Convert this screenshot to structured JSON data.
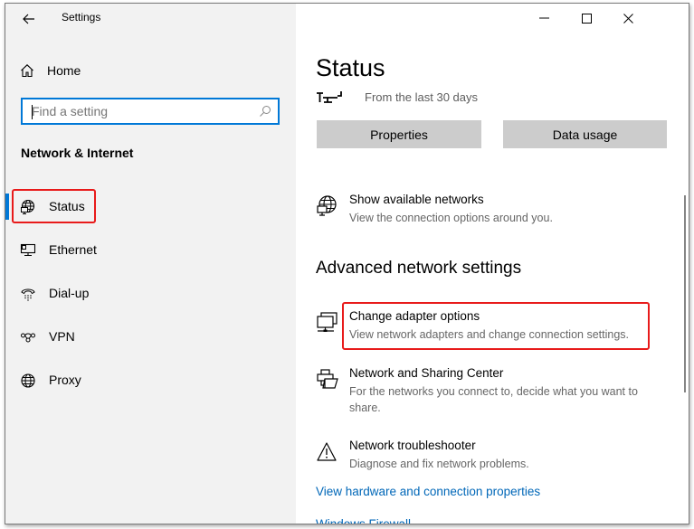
{
  "window": {
    "title": "Settings",
    "controls": {
      "minimize": "minimize-icon",
      "maximize": "maximize-icon",
      "close": "close-icon"
    }
  },
  "sidebar": {
    "back_icon": "back-arrow-icon",
    "home_label": "Home",
    "search": {
      "placeholder": "Find a setting",
      "value": "",
      "icon": "search-icon"
    },
    "section_label": "Network & Internet",
    "selected_index": 0,
    "items": [
      {
        "label": "Status",
        "icon": "status-globe-icon"
      },
      {
        "label": "Ethernet",
        "icon": "ethernet-icon"
      },
      {
        "label": "Dial-up",
        "icon": "dial-up-icon"
      },
      {
        "label": "VPN",
        "icon": "vpn-icon"
      },
      {
        "label": "Proxy",
        "icon": "proxy-globe-icon"
      }
    ]
  },
  "main": {
    "title": "Status",
    "period_text": "From the last 30 days",
    "buttons": {
      "properties": "Properties",
      "data_usage": "Data usage"
    },
    "show_networks": {
      "title": "Show available networks",
      "desc": "View the connection options around you."
    },
    "advanced_heading": "Advanced network settings",
    "options": [
      {
        "title": "Change adapter options",
        "desc": "View network adapters and change connection settings.",
        "icon": "adapter-icon"
      },
      {
        "title": "Network and Sharing Center",
        "desc": "For the networks you connect to, decide what you want to share.",
        "icon": "sharing-center-icon"
      },
      {
        "title": "Network troubleshooter",
        "desc": "Diagnose and fix network problems.",
        "icon": "warning-icon"
      }
    ],
    "links": [
      "View hardware and connection properties",
      "Windows Firewall"
    ]
  },
  "annotations": {
    "highlight_color": "#e81b1b",
    "accent_color": "#0078d7"
  }
}
